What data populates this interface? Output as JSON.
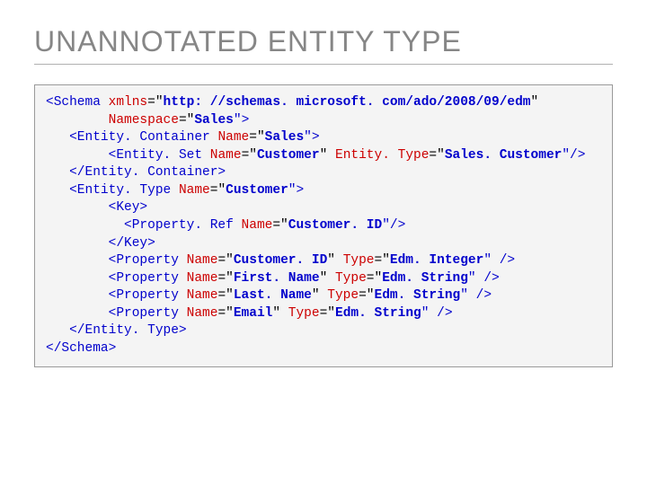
{
  "title": "UNANNOTATED ENTITY TYPE",
  "code": {
    "l1": {
      "open": "<Schema ",
      "a1": "xmlns",
      "eq": "=\"",
      "v1": "http: //schemas. microsoft. com/ado/2008/09/edm",
      "q": "\""
    },
    "l2": {
      "a1": "Namespace",
      "eq": "=\"",
      "v1": "Sales",
      "close": "\">"
    },
    "l3": {
      "open": "<Entity. Container ",
      "a1": "Name",
      "eq": "=\"",
      "v1": "Sales",
      "close": "\">"
    },
    "l4": {
      "open": "<Entity. Set ",
      "a1": "Name",
      "eq": "=\"",
      "v1": "Customer",
      "q": "\" ",
      "a2": "Entity. Type",
      "eq2": "=\"",
      "v2": "Sales. Customer",
      "close": "\"/>"
    },
    "l5": {
      "close": "</Entity. Container>"
    },
    "l6": {
      "open": "<Entity. Type ",
      "a1": "Name",
      "eq": "=\"",
      "v1": "Customer",
      "close": "\">"
    },
    "l7": {
      "open": "<Key>"
    },
    "l8": {
      "open": "<Property. Ref ",
      "a1": "Name",
      "eq": "=\"",
      "v1": "Customer. ID",
      "close": "\"/>"
    },
    "l9": {
      "close": "</Key>"
    },
    "l10": {
      "open": "<Property ",
      "a1": "Name",
      "eq": "=\"",
      "v1": "Customer. ID",
      "q": "\" ",
      "a2": "Type",
      "eq2": "=\"",
      "v2": "Edm. Integer",
      "close": "\" />"
    },
    "l11": {
      "open": "<Property ",
      "a1": "Name",
      "eq": "=\"",
      "v1": "First. Name",
      "q": "\" ",
      "a2": "Type",
      "eq2": "=\"",
      "v2": "Edm. String",
      "close": "\" />"
    },
    "l12": {
      "open": "<Property ",
      "a1": "Name",
      "eq": "=\"",
      "v1": "Last. Name",
      "q": "\" ",
      "a2": "Type",
      "eq2": "=\"",
      "v2": "Edm. String",
      "close": "\" />"
    },
    "l13": {
      "open": "<Property ",
      "a1": "Name",
      "eq": "=\"",
      "v1": "Email",
      "q": "\" ",
      "a2": "Type",
      "eq2": "=\"",
      "v2": "Edm. String",
      "close": "\" />"
    },
    "l14": {
      "close": "</Entity. Type>"
    },
    "l15": {
      "close": "</Schema>"
    }
  }
}
